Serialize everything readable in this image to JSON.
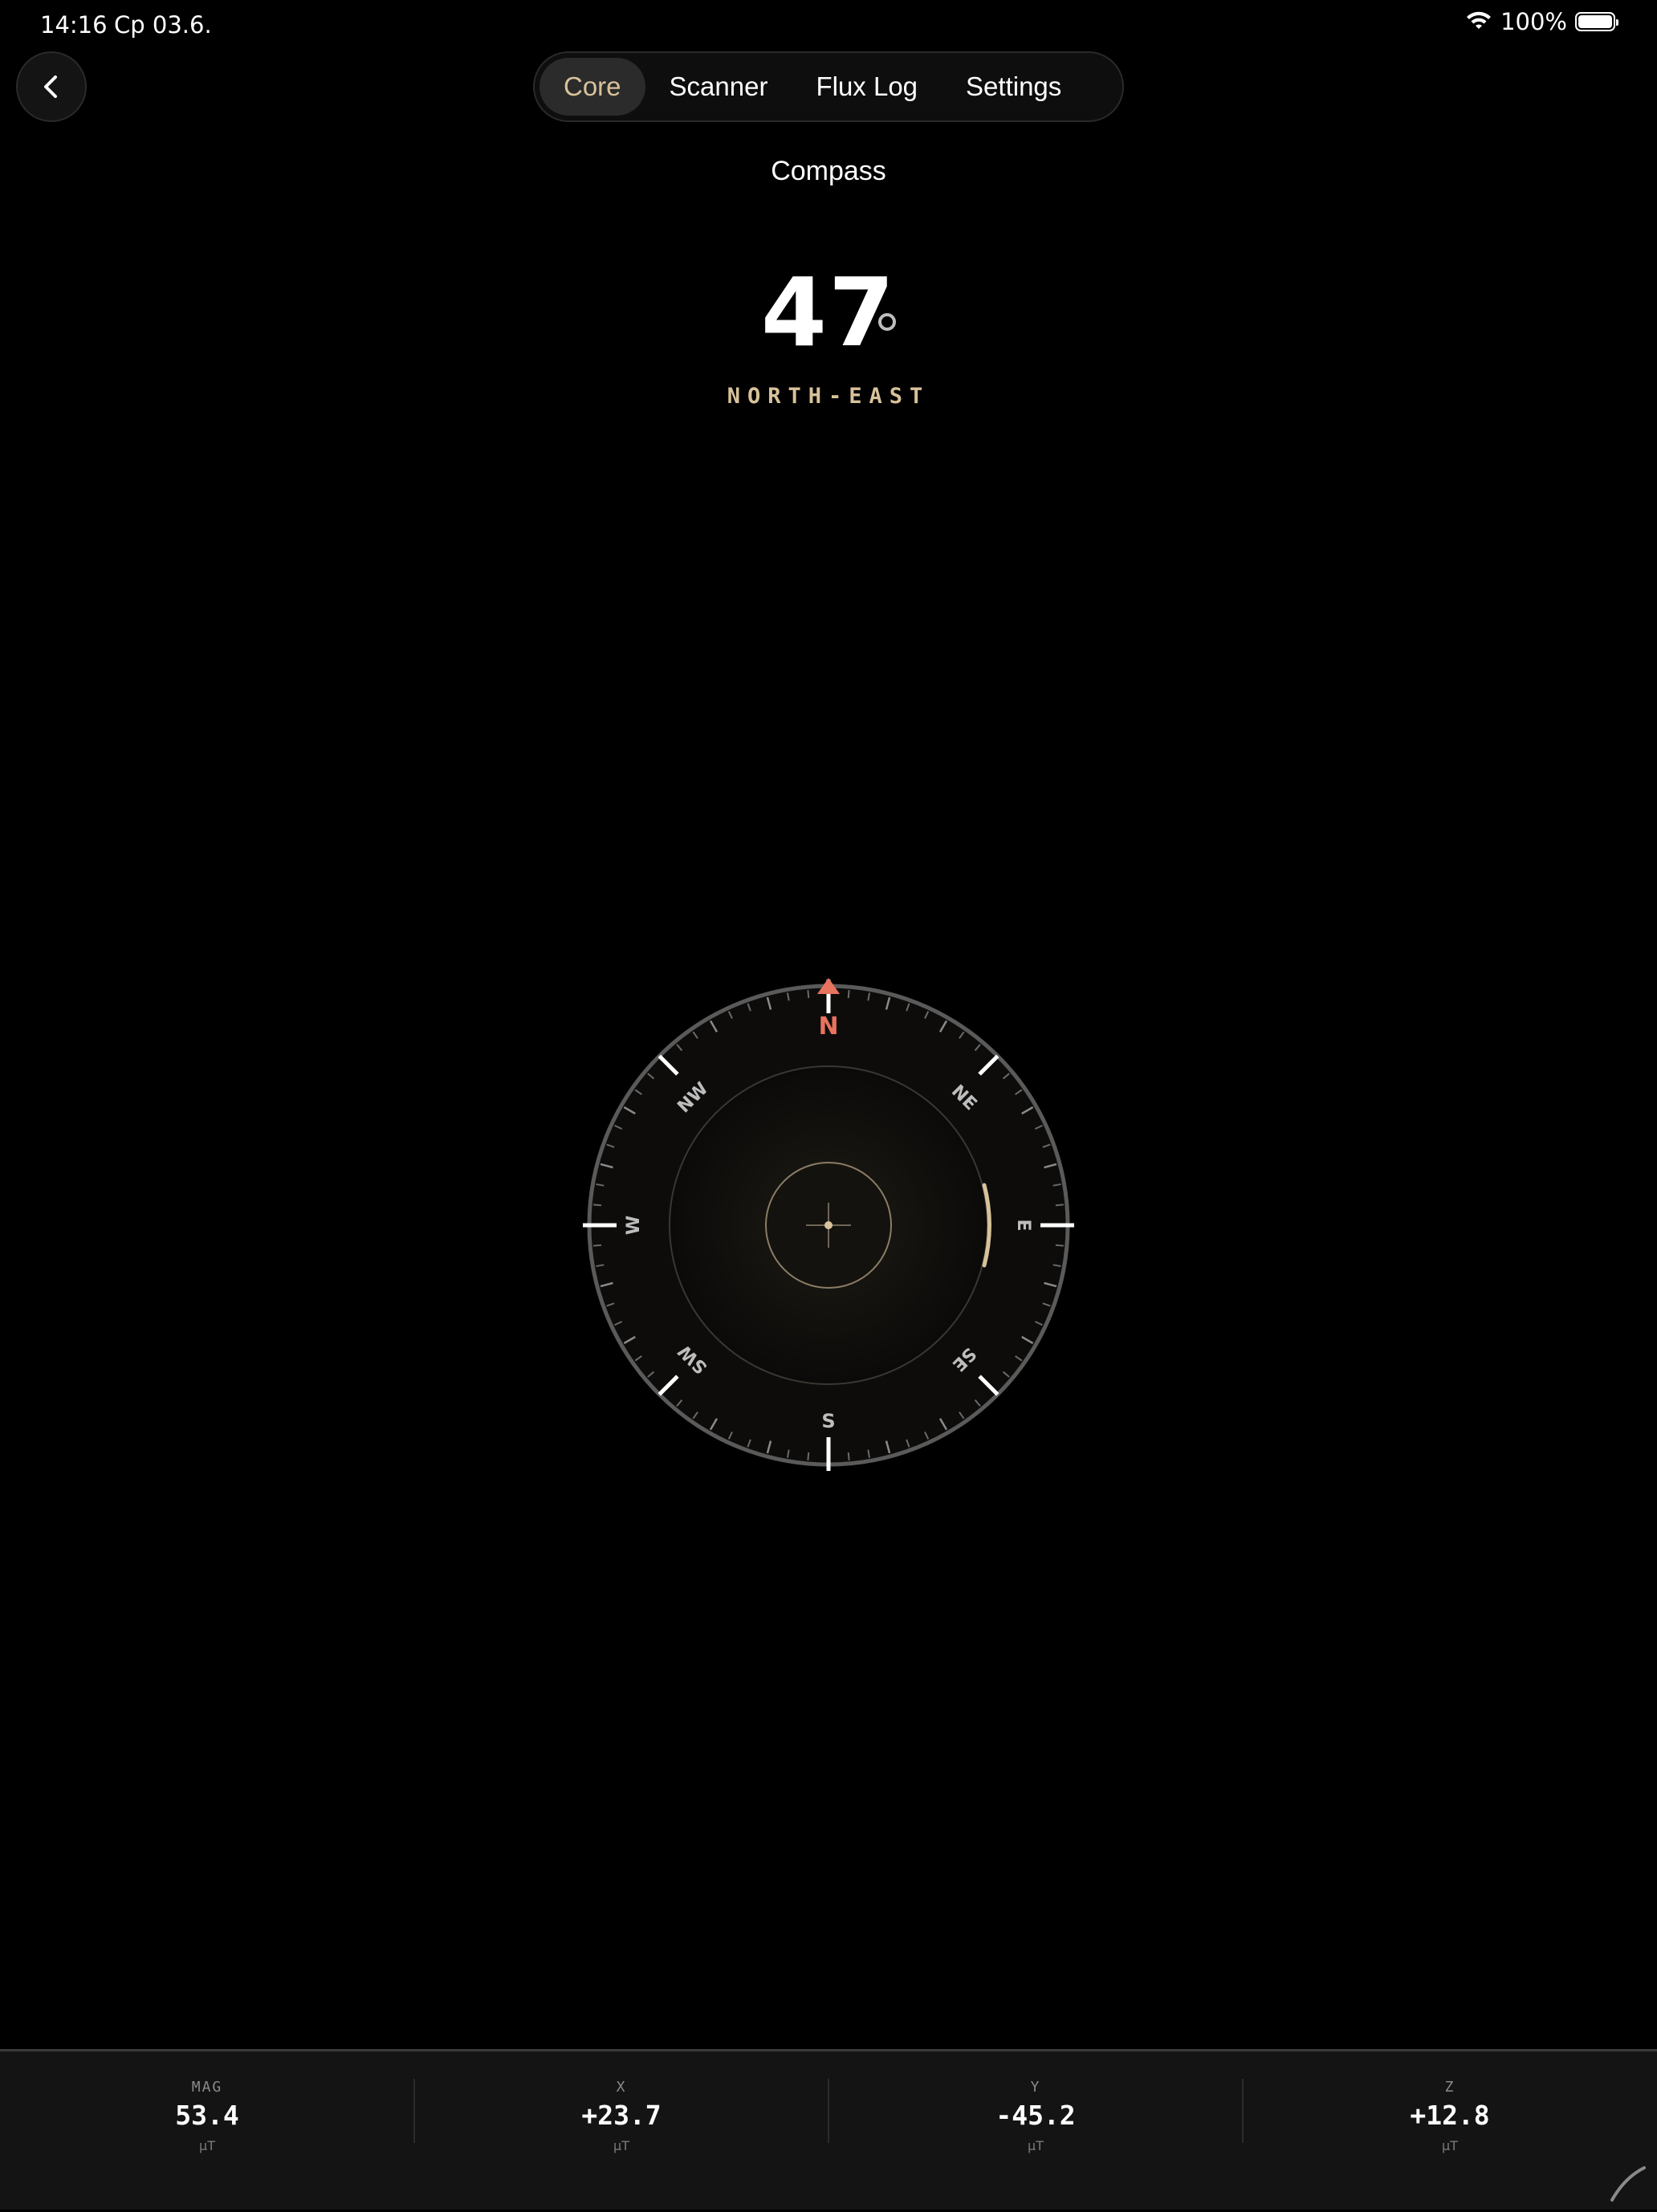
{
  "status_bar": {
    "time": "14:16",
    "date": "Ср 03.6.",
    "battery_percent": "100%",
    "wifi_icon": "wifi-icon",
    "battery_icon": "battery-icon"
  },
  "nav": {
    "back_icon": "chevron-left-icon",
    "tabs": [
      {
        "label": "Core",
        "active": true
      },
      {
        "label": "Scanner",
        "active": false
      },
      {
        "label": "Flux Log",
        "active": false
      },
      {
        "label": "Settings",
        "active": false
      }
    ]
  },
  "page": {
    "title": "Compass"
  },
  "heading": {
    "value": "47",
    "direction": "NORTH-EAST",
    "degrees": 47
  },
  "compass": {
    "labels": {
      "n": "N",
      "ne": "NE",
      "e": "E",
      "se": "SE",
      "s": "S",
      "sw": "SW",
      "w": "W",
      "nw": "NW"
    },
    "north_color": "#e8735e",
    "accent_color": "#d8c29a"
  },
  "stats": [
    {
      "label": "MAG",
      "value": "53.4",
      "unit": "μT"
    },
    {
      "label": "X",
      "value": "+23.7",
      "unit": "μT"
    },
    {
      "label": "Y",
      "value": "-45.2",
      "unit": "μT"
    },
    {
      "label": "Z",
      "value": "+12.8",
      "unit": "μT"
    }
  ]
}
